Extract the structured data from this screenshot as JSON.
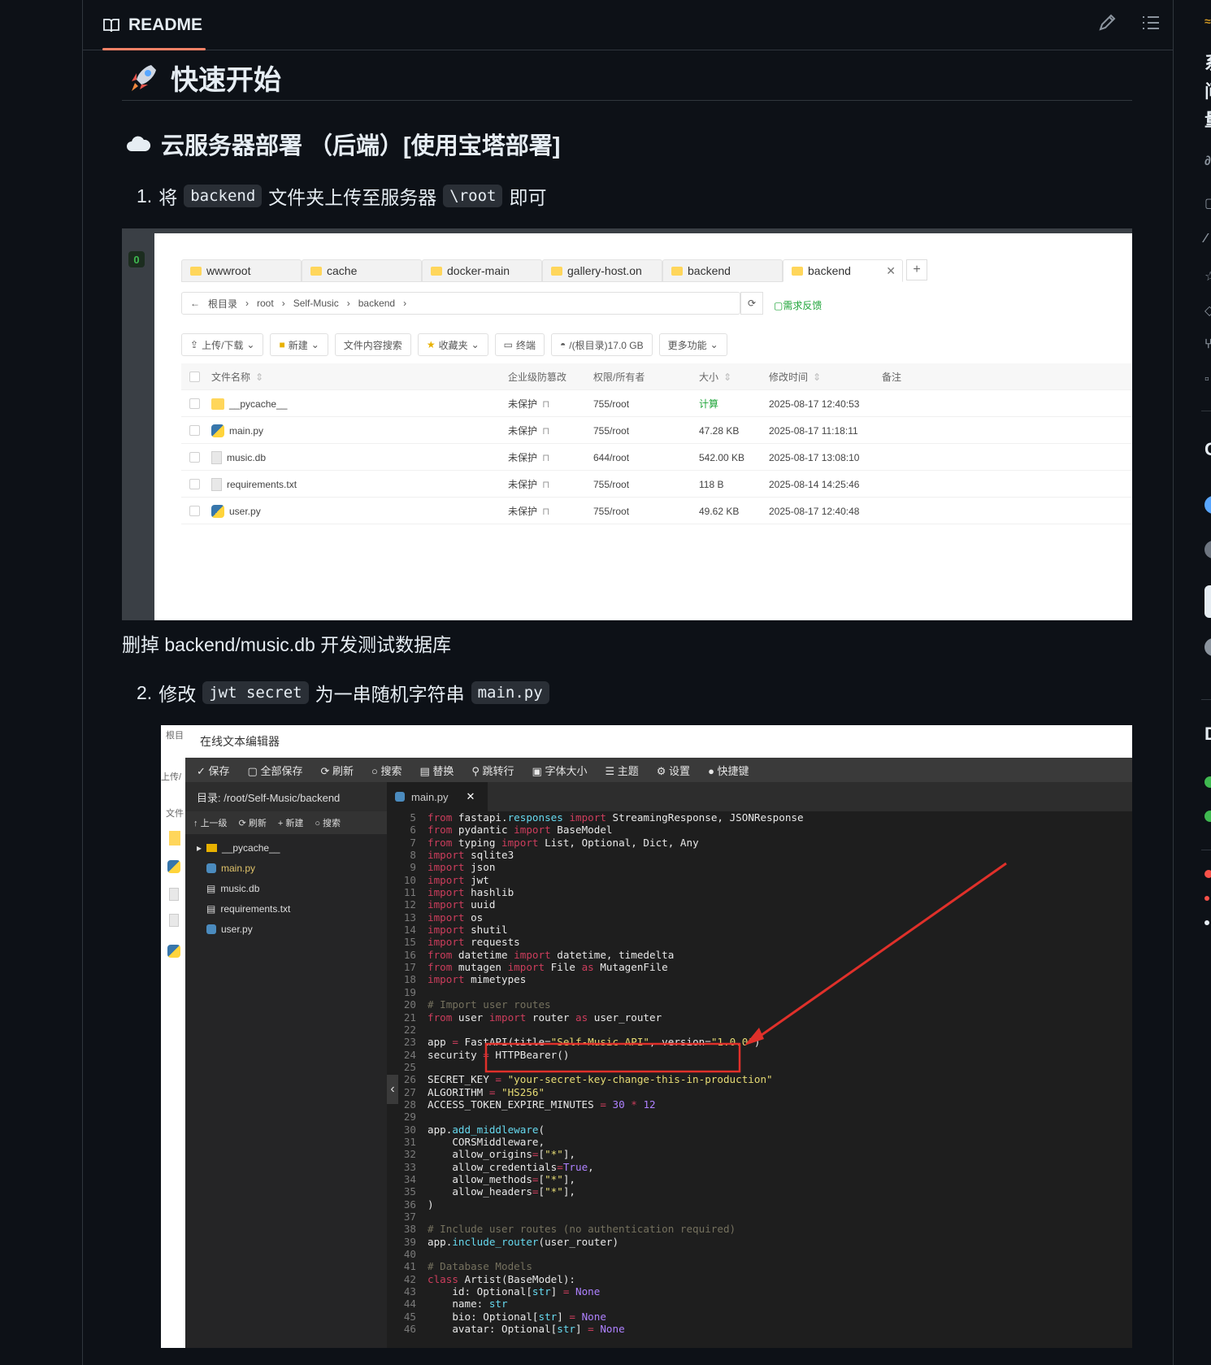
{
  "readme": {
    "tab_label": "README",
    "title": "快速开始",
    "section_title": "云服务器部署 （后端）[使用宝塔部署]",
    "step1": {
      "num": "1.",
      "pre": "将",
      "code1": "backend",
      "mid": "文件夹上传至服务器",
      "code2": "\\root",
      "post": "即可"
    },
    "note": "删掉 backend/music.db 开发测试数据库",
    "step2": {
      "num": "2.",
      "pre": "修改",
      "code1": "jwt secret",
      "mid": "为一串随机字符串",
      "code2": "main.py"
    }
  },
  "shot1": {
    "badge": "0",
    "tabs": [
      "wwwroot",
      "cache",
      "docker-main",
      "gallery-host.on",
      "backend",
      "backend"
    ],
    "breadcrumb": [
      "根目录",
      "root",
      "Self-Music",
      "backend"
    ],
    "feedback": "需求反馈",
    "toolbar": [
      "上传/下载",
      "新建",
      "文件内容搜索",
      "收藏夹",
      "终端",
      "/(根目录)17.0 GB",
      "更多功能"
    ],
    "headers": [
      "文件名称",
      "企业级防篡改",
      "权限/所有者",
      "大小",
      "修改时间",
      "备注"
    ],
    "rows": [
      {
        "name": "__pycache__",
        "icon": "folder",
        "protect": "未保护",
        "perm": "755/root",
        "size": "计算",
        "time": "2025-08-17 12:40:53"
      },
      {
        "name": "main.py",
        "icon": "python",
        "protect": "未保护",
        "perm": "755/root",
        "size": "47.28 KB",
        "time": "2025-08-17 11:18:11"
      },
      {
        "name": "music.db",
        "icon": "doc",
        "protect": "未保护",
        "perm": "644/root",
        "size": "542.00 KB",
        "time": "2025-08-17 13:08:10"
      },
      {
        "name": "requirements.txt",
        "icon": "doc",
        "protect": "未保护",
        "perm": "755/root",
        "size": "118 B",
        "time": "2025-08-14 14:25:46"
      },
      {
        "name": "user.py",
        "icon": "python",
        "protect": "未保护",
        "perm": "755/root",
        "size": "49.62 KB",
        "time": "2025-08-17 12:40:48"
      }
    ]
  },
  "shot2": {
    "left_labels": [
      "根目",
      "上传/",
      "文件"
    ],
    "title": "在线文本编辑器",
    "toolbar": [
      "保存",
      "全部保存",
      "刷新",
      "搜索",
      "替换",
      "跳转行",
      "字体大小",
      "主题",
      "设置",
      "快捷键"
    ],
    "dir_label": "目录: /root/Self-Music/backend",
    "side_buttons": [
      "上一级",
      "刷新",
      "新建",
      "搜索"
    ],
    "tree": [
      "__pycache__",
      "main.py",
      "music.db",
      "requirements.txt",
      "user.py"
    ],
    "tab": "main.py",
    "highlight_color": "#e0302a"
  },
  "colors": {
    "accent_tab": "#f78166",
    "bt_green": "#20a53a"
  }
}
